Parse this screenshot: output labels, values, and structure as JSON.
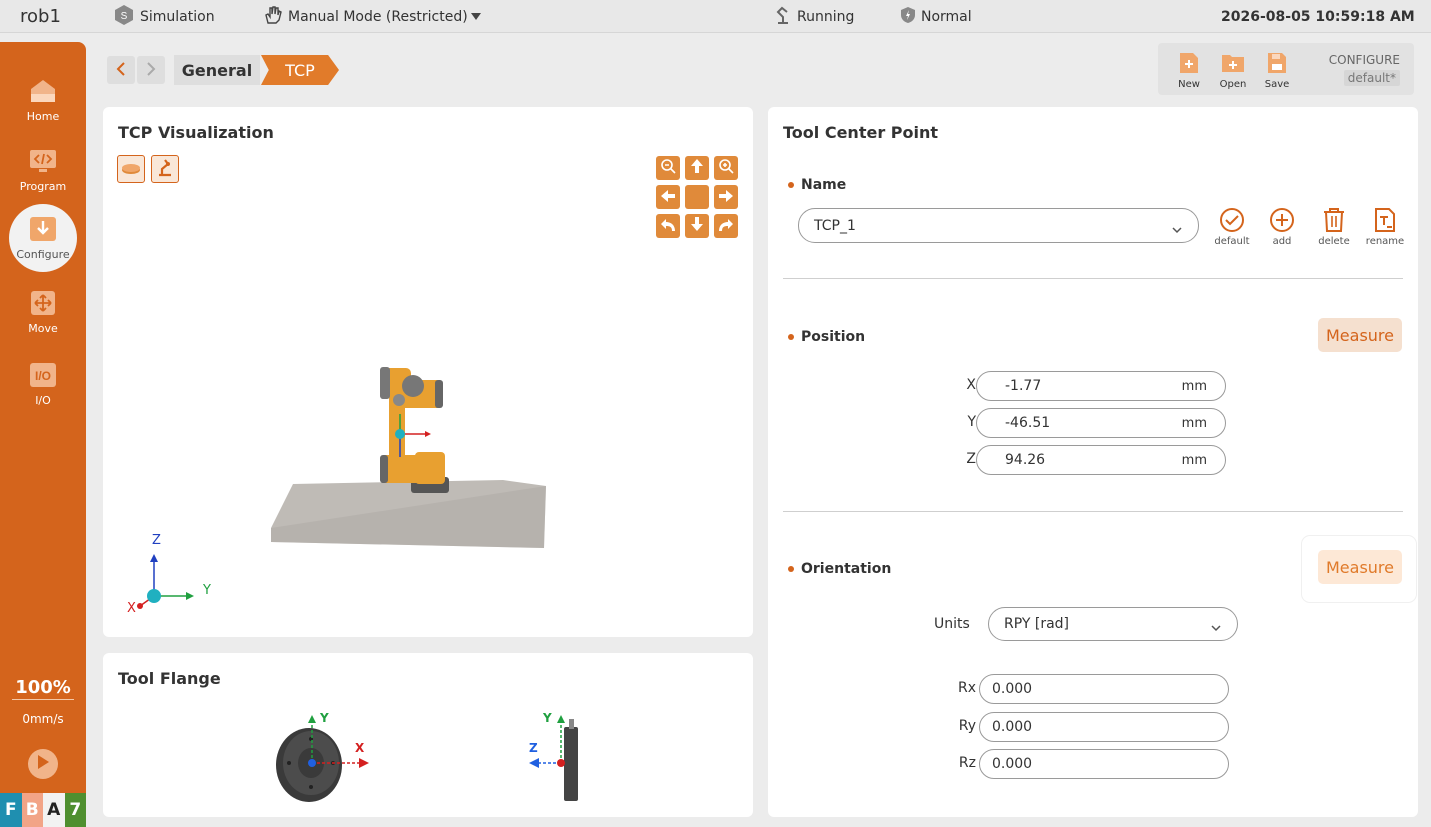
{
  "topbar": {
    "robot_name": "rob1",
    "simulation": "Simulation",
    "mode": "Manual Mode (Restricted)",
    "run_state": "Running",
    "safety": "Normal",
    "datetime": "2026-08-05 10:59:18 AM"
  },
  "sidebar": {
    "items": [
      {
        "label": "Home",
        "icon": "home-icon"
      },
      {
        "label": "Program",
        "icon": "code-icon"
      },
      {
        "label": "Configure",
        "icon": "configure-icon",
        "active": true
      },
      {
        "label": "Move",
        "icon": "move-icon"
      },
      {
        "label": "I/O",
        "icon": "io-icon"
      }
    ],
    "speed_percent": "100%",
    "speed_value": "0mm/s",
    "mode_tiles": [
      "F",
      "B",
      "A",
      "7"
    ]
  },
  "breadcrumb": [
    "General",
    "TCP"
  ],
  "file_toolbar": {
    "new_label": "New",
    "open_label": "Open",
    "save_label": "Save",
    "configure_label": "CONFIGURE",
    "config_name": "default*"
  },
  "tcp_visualization": {
    "title": "TCP Visualization",
    "axes": {
      "z": "Z",
      "y": "Y",
      "x": "X"
    }
  },
  "tool_flange": {
    "title": "Tool Flange",
    "front_axes": {
      "y": "Y",
      "x": "X"
    },
    "side_axes": {
      "y": "Y",
      "z": "Z"
    }
  },
  "tool_center_point": {
    "title": "Tool Center Point",
    "name_label": "Name",
    "name_value": "TCP_1",
    "actions": {
      "default": "default",
      "add": "add",
      "delete": "delete",
      "rename": "rename"
    },
    "position_label": "Position",
    "measure_label": "Measure",
    "position": [
      {
        "axis": "X",
        "value": "-1.77",
        "unit": "mm"
      },
      {
        "axis": "Y",
        "value": "-46.51",
        "unit": "mm"
      },
      {
        "axis": "Z",
        "value": "94.26",
        "unit": "mm"
      }
    ],
    "orientation_label": "Orientation",
    "units_label": "Units",
    "units_value": "RPY [rad]",
    "orientation": [
      {
        "axis": "Rx",
        "value": "0.000"
      },
      {
        "axis": "Ry",
        "value": "0.000"
      },
      {
        "axis": "Rz",
        "value": "0.000"
      }
    ]
  },
  "colors": {
    "accent": "#d4641c",
    "panel": "#ffffff",
    "background": "#ececec"
  }
}
